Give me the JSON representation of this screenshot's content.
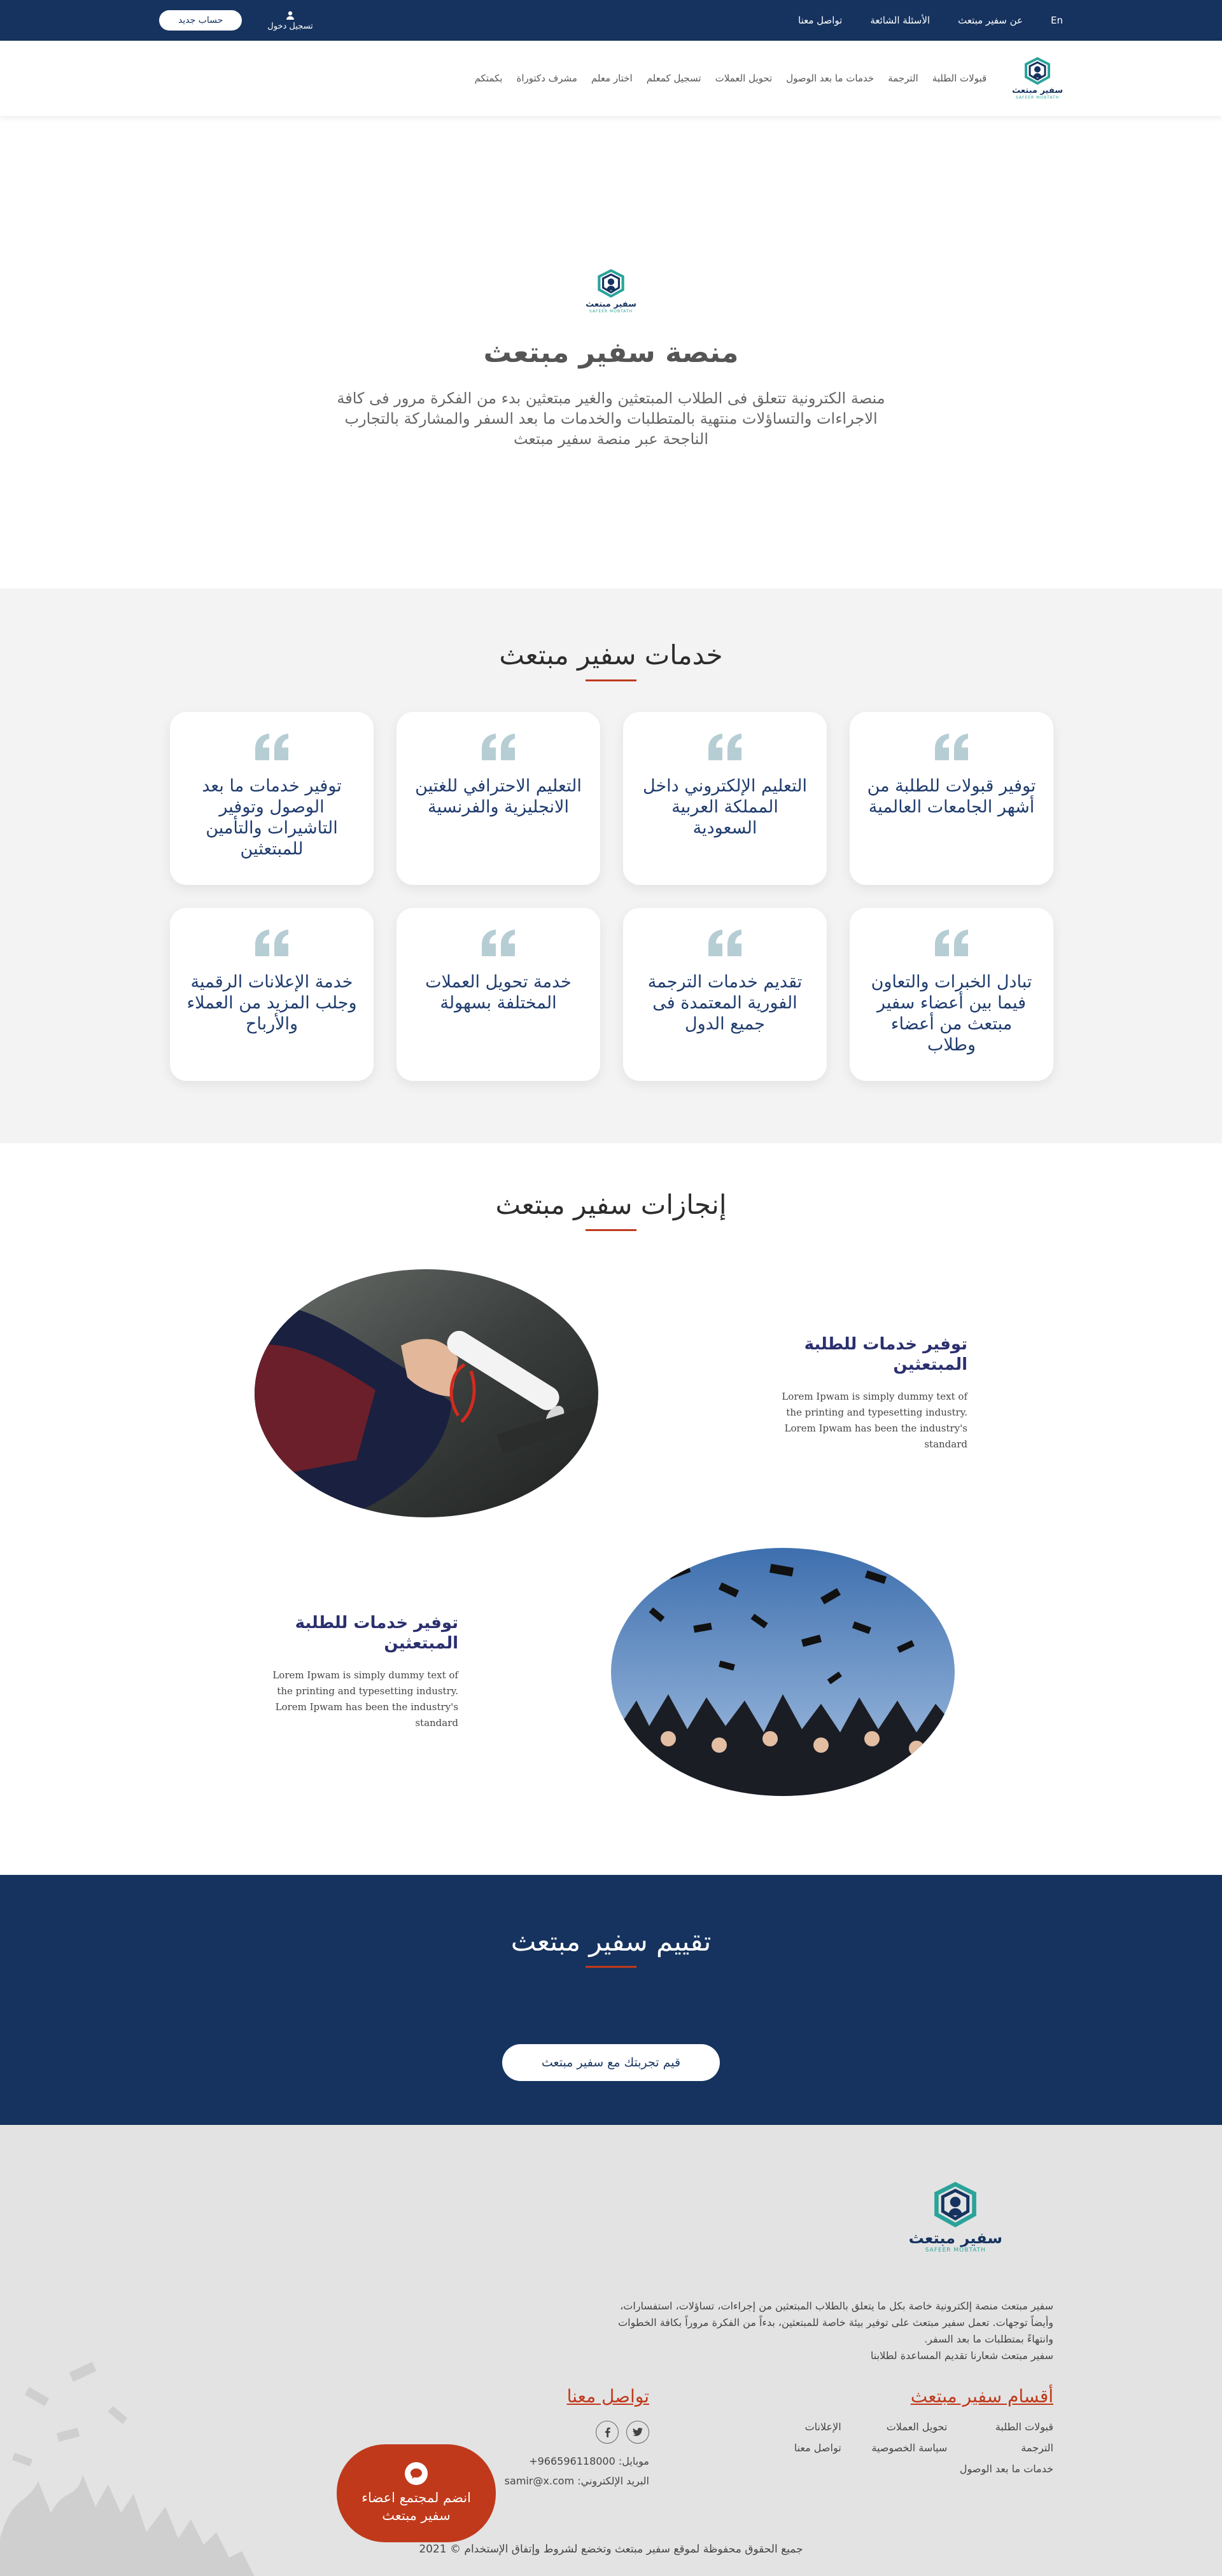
{
  "topbar": {
    "lang": "En",
    "about": "عن سفير مبتعث",
    "faq": "الأسئلة الشائعة",
    "contact": "تواصل معنا",
    "login": "تسجيل دخول",
    "new_account": "حساب جديد"
  },
  "nav": {
    "logo_text": "سفير مبتعث",
    "logo_sub": "SAFEER MOBTATH",
    "items": [
      {
        "label": "قبولات الطلبة"
      },
      {
        "label": "الترجمة"
      },
      {
        "label": "خدمات ما بعد الوصول"
      },
      {
        "label": "تحويل العملات"
      },
      {
        "label": "تسجيل كمعلم"
      },
      {
        "label": "اختار معلم"
      },
      {
        "label": "مشرف دكتوراة"
      },
      {
        "label": "بكمتكم"
      }
    ]
  },
  "hero": {
    "logo_text": "سفير مبتعث",
    "logo_sub": "SAFEER MOBTATH",
    "title": "منصة سفير مبتعث",
    "description": "منصة الكترونية تتعلق فى الطلاب المبتعثين والغير مبتعثين بدء من الفكرة مرور فى كافة الاجراءات والتساؤلات منتهية بالمتطلبات والخدمات ما بعد السفر والمشاركة بالتجارب الناجحة عبر منصة سفير مبتعث"
  },
  "services": {
    "title": "خدمات سفير مبتعث",
    "cards": [
      {
        "text": "توفير قبولات للطلبة من أشهر الجامعات العالمية"
      },
      {
        "text": "التعليم الإلكتروني داخل المملكة العربية السعودية"
      },
      {
        "text": "التعليم الاحترافي للغتين الانجليزية والفرنسية"
      },
      {
        "text": "توفير خدمات ما بعد الوصول وتوفير التاشيرات والتأمين للمبتعثين"
      },
      {
        "text": "تبادل الخبرات والتعاون فيما بين أعضاء سفير مبتعث من أعضاء وطلاب"
      },
      {
        "text": "تقديم خدمات الترجمة الفورية المعتمدة فى جميع الدول"
      },
      {
        "text": "خدمة تحويل العملات المختلفة بسهولة"
      },
      {
        "text": "خدمة الإعلانات الرقمية وجلب المزيد من العملاء والأرباح"
      }
    ]
  },
  "achievements": {
    "title": "إنجازات سفير مبتعث",
    "items": [
      {
        "heading": "توفير خدمات للطلبة المبتعثين",
        "text": "Lorem Ipwam is simply dummy text of the printing and typesetting industry. Lorem Ipwam has been the industry's standard"
      },
      {
        "heading": "توفير خدمات للطلبة المبتعثين",
        "text": "Lorem Ipwam is simply dummy text of the printing and typesetting industry. Lorem Ipwam has been the industry's standard"
      }
    ]
  },
  "rating": {
    "title": "تقييم سفير مبتعث",
    "button": "قيم تجربتك مع سفير مبتعث"
  },
  "footer": {
    "logo_text": "سفير مبتعث",
    "logo_sub": "SAFEER MOBTATH",
    "desc": [
      "سفير مبتعث منصة إلكترونية خاصة بكل ما يتعلق بالطلاب المبتعثين من إجراءات، تساؤلات، استفسارات،",
      "وأيضاً توجهات. تعمل سفير مبتعث على توفير بيئة خاصة للمبتعثين، بدءاً من الفكرة مروراً بكافة الخطوات",
      "وانتهاءً بمتطلبات ما بعد السفر.",
      "سفير مبتعث شعارنا تقديم المساعدة لطلابنا"
    ],
    "sections_title": "أقسام سفير مبتعث",
    "sections": [
      {
        "label": "قبولات الطلبة"
      },
      {
        "label": "تحويل العملات"
      },
      {
        "label": "الإعلانات"
      },
      {
        "label": "الترجمة"
      },
      {
        "label": "سياسة الخصوصية"
      },
      {
        "label": "تواصل معنا"
      },
      {
        "label": "خدمات ما بعد الوصول"
      }
    ],
    "contact_title": "تواصل معنا",
    "mobile": "موبايل: 966596118000+",
    "email": "البريد الإلكتروني: samir@x.com",
    "copyright": "جميع الحقوق محفوظة لموقع سفير مبتعث وتخضع لشروط وإتفاق الإستخدام © 2021",
    "join": [
      "انضم لمجتمع اعضاء",
      "سفير مبتعث"
    ]
  },
  "colors": {
    "navy": "#16335f",
    "accent_red": "#c0391b",
    "teal": "#2aa39a",
    "gray_section": "#f3f3f3",
    "footer_bg": "#e3e3e3"
  }
}
